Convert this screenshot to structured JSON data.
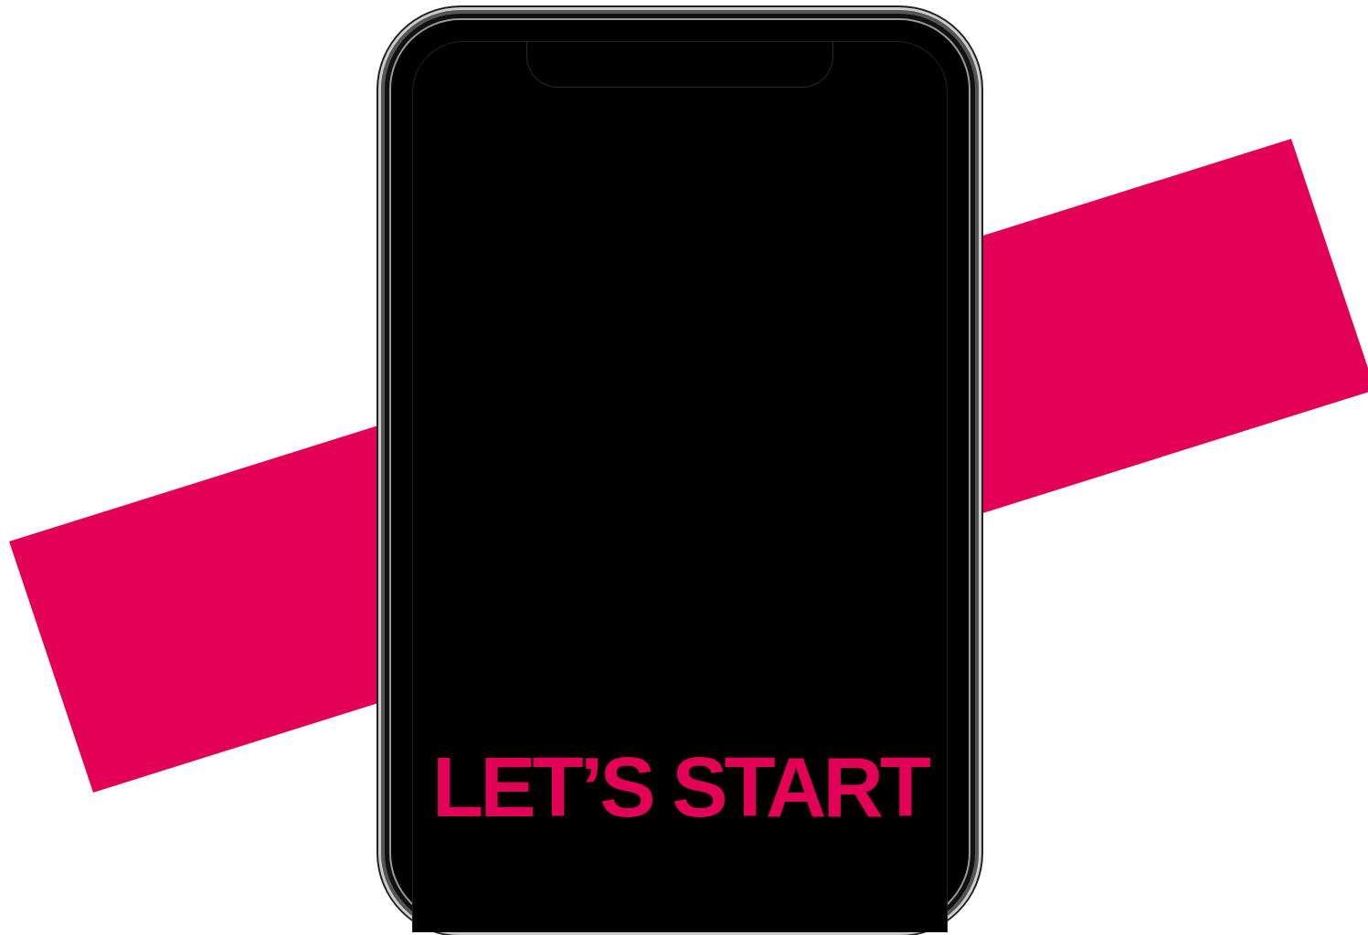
{
  "phone_screen": {
    "headline": "LET’S START"
  }
}
